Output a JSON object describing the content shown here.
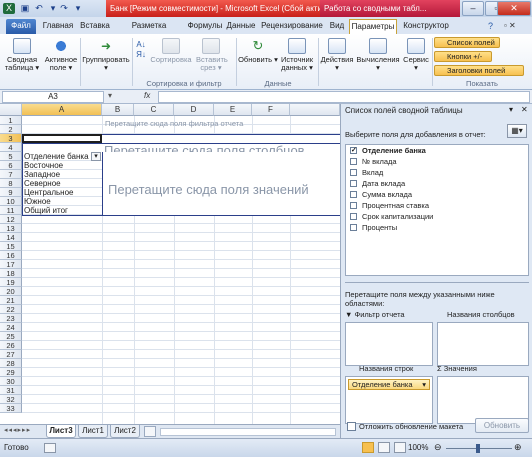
{
  "window": {
    "doc_title": "Банк [Режим совместимости] - Microsoft Excel (Сбой активации)",
    "context_title": "Работа со сводными табл...",
    "buttons": [
      "–",
      "▫",
      "✕"
    ]
  },
  "tabs": [
    "Файл",
    "Главная",
    "Вставка",
    "Разметка страницы",
    "Формулы",
    "Данные",
    "Рецензирование",
    "Вид",
    "Параметры",
    "Конструктор"
  ],
  "ribbon": {
    "pivot_table": "Сводная таблица",
    "active_field": "Активное поле",
    "group": "Группировать",
    "sort": "Сортировка",
    "insert_slicer": "Вставить срез",
    "refresh": "Обновить",
    "data_source": "Источник данных",
    "actions": "Действия",
    "calculations": "Вычисления",
    "service": "Сервис",
    "field_list": "Список полей",
    "buttons_pm": "Кнопки +/-",
    "field_headers": "Заголовки полей",
    "group_sort_filter": "Сортировка и фильтр",
    "group_data": "Данные",
    "group_show": "Показать"
  },
  "formula_bar": {
    "name_box": "A3",
    "fx": "fx",
    "value": ""
  },
  "grid": {
    "columns": [
      "A",
      "B",
      "C",
      "D",
      "E",
      "F"
    ],
    "rows": [
      "1",
      "2",
      "3",
      "4",
      "5",
      "6",
      "7",
      "8",
      "9",
      "10",
      "11",
      "12",
      "13",
      "14",
      "15",
      "16",
      "17",
      "18",
      "19",
      "20",
      "21",
      "22",
      "23",
      "24",
      "25",
      "26",
      "27",
      "28",
      "29",
      "30",
      "31",
      "32",
      "33"
    ],
    "filter_drop_hint": "Перетащите сюда поля фильтра отчета",
    "col_drop_hint": "Перетащите сюда поля столбцов",
    "value_drop_hint": "Перетащите сюда поля значений",
    "row_header": "Отделение банка",
    "row_values": [
      "Восточное",
      "Западное",
      "Северное",
      "Центральное",
      "Южное"
    ],
    "grand_total": "Общий итог"
  },
  "sheets": [
    "Лист3",
    "Лист1",
    "Лист2"
  ],
  "status": {
    "ready": "Готово",
    "zoom": "100%"
  },
  "pane": {
    "title": "Список полей сводной таблицы",
    "choose_fields": "Выберите поля для добавления в отчет:",
    "fields": [
      {
        "name": "Отделение банка",
        "checked": true
      },
      {
        "name": "№ вклада",
        "checked": false
      },
      {
        "name": "Вклад",
        "checked": false
      },
      {
        "name": "Дата вклада",
        "checked": false
      },
      {
        "name": "Сумма вклада",
        "checked": false
      },
      {
        "name": "Процентная ставка",
        "checked": false
      },
      {
        "name": "Срок капитализации",
        "checked": false
      },
      {
        "name": "Проценты",
        "checked": false
      }
    ],
    "drag_hint": "Перетащите поля между указанными ниже областями:",
    "area_filter": "Фильтр отчета",
    "area_columns": "Названия столбцов",
    "area_rows": "Названия строк",
    "area_values": "Значения",
    "row_item": "Отделение банка",
    "defer_update": "Отложить обновление макета",
    "update_button": "Обновить"
  }
}
